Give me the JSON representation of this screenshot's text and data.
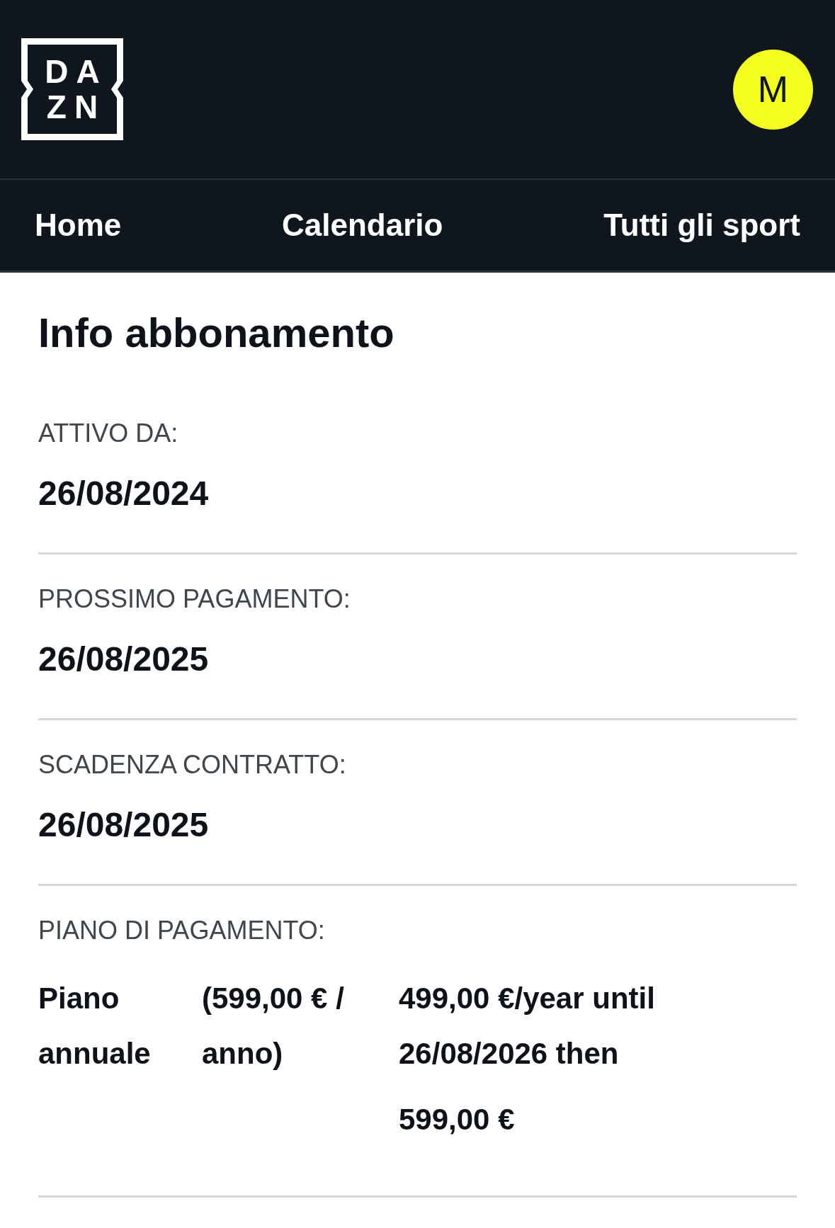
{
  "header": {
    "logo": {
      "lines": [
        "DA",
        "ZN"
      ]
    },
    "avatar": {
      "initial": "M"
    }
  },
  "nav": {
    "items": [
      {
        "label": "Home"
      },
      {
        "label": "Calendario"
      },
      {
        "label": "Tutti gli sport"
      }
    ]
  },
  "page": {
    "title": "Info abbonamento",
    "fields": [
      {
        "kind": "date",
        "label": "ATTIVO DA:",
        "value": "26/08/2024"
      },
      {
        "kind": "date",
        "label": "PROSSIMO PAGAMENTO:",
        "value": "26/08/2025"
      },
      {
        "kind": "date",
        "label": "SCADENZA CONTRATTO:",
        "value": "26/08/2025"
      },
      {
        "kind": "plan",
        "label": "PIANO DI PAGAMENTO:",
        "plan_name": "Piano annuale",
        "price": "(599,00 € / anno)",
        "offer": [
          "499,00 €/year until 26/08/2026 then",
          "599,00 €"
        ]
      }
    ]
  }
}
